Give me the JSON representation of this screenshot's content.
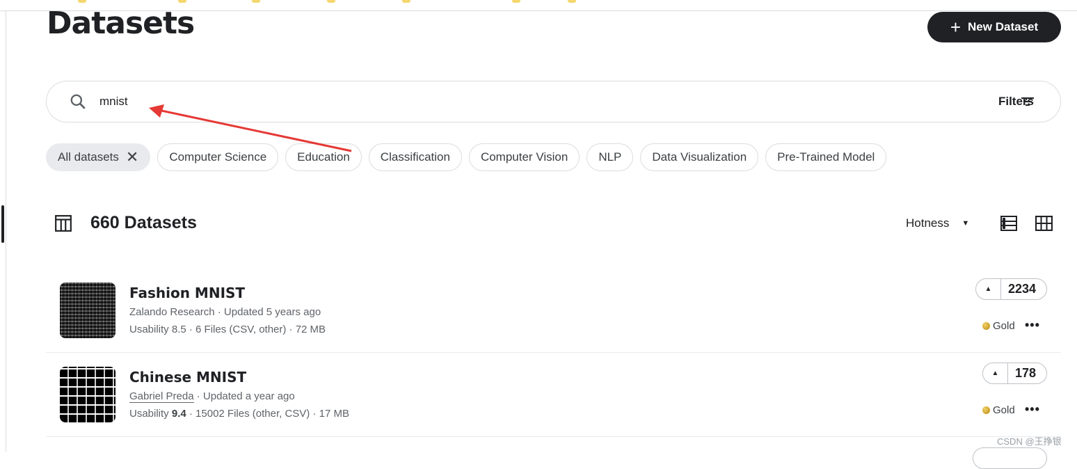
{
  "header": {
    "title": "Datasets",
    "new_button": "New Dataset"
  },
  "search": {
    "value": "mnist",
    "filters_label": "Filters"
  },
  "chips": [
    "All datasets",
    "Computer Science",
    "Education",
    "Classification",
    "Computer Vision",
    "NLP",
    "Data Visualization",
    "Pre-Trained Model"
  ],
  "results": {
    "count_label": "660 Datasets",
    "sort_label": "Hotness"
  },
  "datasets": [
    {
      "title": "Fashion MNIST",
      "owner": "Zalando Research",
      "updated": " · Updated 5 years ago",
      "usability_prefix": "Usability ",
      "usability": "8.5",
      "files": " · 6 Files (CSV, other) · 72 MB",
      "votes": "2234",
      "medal": "Gold"
    },
    {
      "title": "Chinese MNIST",
      "owner": "Gabriel Preda",
      "updated": " · Updated a year ago",
      "usability_prefix": "Usability ",
      "usability": "9.4",
      "files": " · 15002 Files (other, CSV) · 17 MB",
      "votes": "178",
      "medal": "Gold"
    }
  ],
  "watermark": "CSDN @王挣银",
  "colors": {
    "primary_button": "#202124",
    "annotation_arrow": "#e53935",
    "gold": "#c9961a"
  }
}
